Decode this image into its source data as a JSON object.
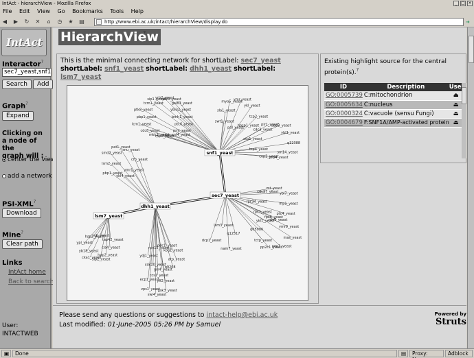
{
  "window": {
    "title": "IntAct - hierarchView - Mozilla Firefox"
  },
  "menu": [
    "File",
    "Edit",
    "View",
    "Go",
    "Bookmarks",
    "Tools",
    "Help"
  ],
  "url": "http://www.ebi.ac.uk/intact/hierarchView/display.do",
  "sidebar": {
    "logo": "IntAct",
    "interactor_label": "Interactor",
    "interactor_value": "sec7_yeast,snf1_y",
    "search_label": "Search",
    "add_label": "Add",
    "graph_label": "Graph",
    "expand_label": "Expand",
    "clicking_text": [
      "Clicking on",
      "a node of the",
      "graph will :"
    ],
    "center_view": "center the view",
    "add_network": "add a network",
    "psixml_label": "PSI-XML",
    "download_label": "Download",
    "mine_label": "Mine",
    "clear_label": "Clear path",
    "links_label": "Links",
    "intact_home": "IntAct home",
    "back_to_search": "Back to search",
    "user_label": "User:",
    "user_value": "INTACTWEB"
  },
  "main": {
    "title": "HierarchView",
    "intro": "This is the minimal connecting network for shortLabel:",
    "shortlabel_word": "shortLabel:",
    "proteins": [
      "sec7_yeast",
      "snf1_yeast",
      "dhh1_yeast",
      "lsm7_yeast"
    ],
    "highlight_text": "Existing highlight source for the central protein(s).",
    "go_table": {
      "headers": [
        "ID",
        "Description",
        "Use"
      ],
      "rows": [
        {
          "id": "GO:0005739",
          "desc": "C:mitochondrion"
        },
        {
          "id": "GO:0005634",
          "desc": "C:nucleus"
        },
        {
          "id": "GO:0000324",
          "desc": "C:vacuole (sensu Fungi)"
        },
        {
          "id": "GO:0004679",
          "desc": "F:SNF1A/AMP-activated protein"
        }
      ]
    },
    "footer_text": "Please send any questions or suggestions to",
    "footer_email": "intact-help@ebi.ac.uk",
    "last_modified": "Last modified:",
    "last_modified_value": "01-June-2005 05:26 PM by Samuel",
    "powered_by": "Powered by",
    "struts": "Struts"
  },
  "graph": {
    "highlighted": [
      "snf1_yeast",
      "sec7_yeast",
      "dhh1_yeast",
      "lsm7_yeast"
    ],
    "labels": [
      "bmh1_yeast",
      "ptc6_yeast",
      "pmt_yeast",
      "pnm_snf4_yeast",
      "rpp2_yeast",
      "mkk2_yeast",
      "cdc8_yeast",
      "lcm1_yeast",
      "pbp1_yeast",
      "ptk8_yeast",
      "tcm1_yeast",
      "sip1_yeast",
      "yrb2_yeast",
      "ptk1_yeast",
      "gal83_yeast",
      "ybl32_yeast",
      "hpsp1_yeast",
      "pdl_yeast",
      "swt1_yeast",
      "sla1_yeast",
      "myo5_yeast",
      "ymr_yeast",
      "ykl_yeast",
      "tcp2_yeast",
      "cop2_yeast",
      "tcp4_yeast",
      "atp1_yeast",
      "cdc3_yeast",
      "pir1_yeast",
      "ubp3_yeast",
      "ybl1_yeast",
      "q12388",
      "sm14_yeast",
      "prp4_yeast",
      "lsm2_yeast",
      "smd2_yeast",
      "pat1_yeast",
      "snu_yeast",
      "crb_yeast",
      "ymr1_yeast",
      "ykl4_yeast",
      "pbp1_yeast",
      "cdc37_yeast",
      "mt_yeast",
      "ybl7_yeast",
      "mp1_yeast",
      "ptc4_yeast",
      "rpc6_yeast",
      "rpc1_yeast",
      "rpc34_yeast",
      "rpc8_yeast",
      "ymr9_yeast",
      "mas_yeast",
      "pep3_yeast",
      "pp2c1_yeast",
      "tctp_yeast",
      "q05986",
      "ykl1_yeast",
      "q12517",
      "nam7_yeast",
      "dcp1_yeast",
      "lsm3_yeast",
      "hap2_yeast",
      "sip2_yeast",
      "cka1_yeast",
      "yb18_yeast",
      "ypl_yeast",
      "hsp2_yeast",
      "rvb_yeast",
      "tap42_yeast",
      "cla4_yeast",
      "gin4_yeast",
      "cdc10_yeast",
      "ydj1_yeast",
      "rpn12_yeast",
      "pdc1_yeast",
      "kog1_yeast",
      "atp_yeast",
      "q9208",
      "vps1_yeast",
      "ecp1_yeast",
      "ccs1_yeast",
      "yff2_yeast",
      "gsk3_yeast",
      "swi4_yeast"
    ]
  }
}
